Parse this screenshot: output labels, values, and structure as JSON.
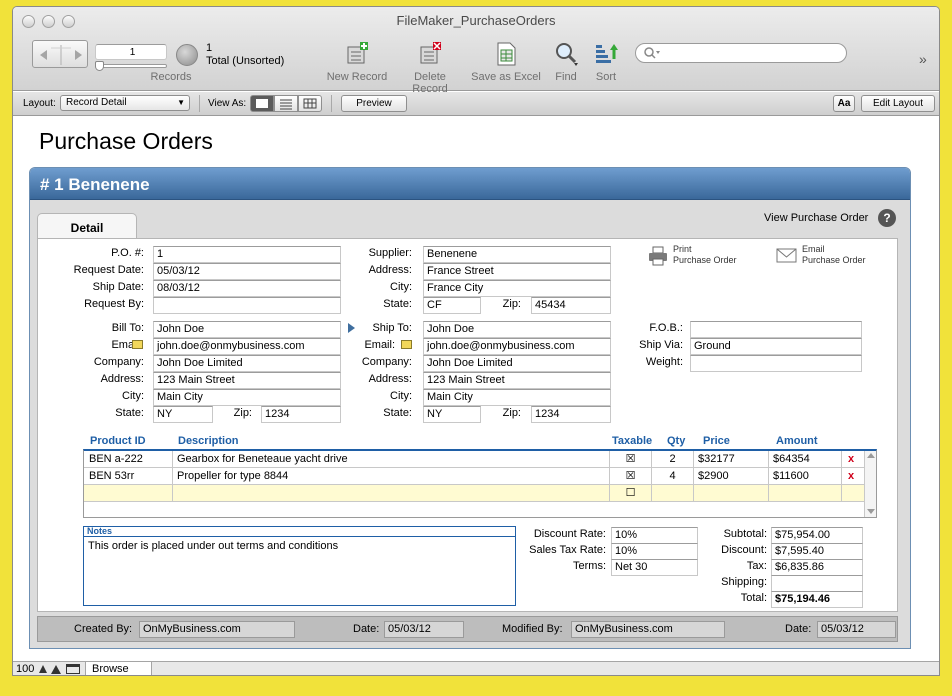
{
  "window": {
    "title": "FileMaker_PurchaseOrders"
  },
  "toolbar": {
    "record_number": "1",
    "record_count": "1",
    "record_status": "Total (Unsorted)",
    "records_label": "Records",
    "buttons": [
      {
        "label": "New Record",
        "icon": "new-record-icon"
      },
      {
        "label": "Delete Record",
        "icon": "delete-record-icon"
      },
      {
        "label": "Save as Excel",
        "icon": "save-excel-icon"
      },
      {
        "label": "Find",
        "icon": "find-icon"
      },
      {
        "label": "Sort",
        "icon": "sort-icon"
      }
    ],
    "search_placeholder": ""
  },
  "layoutbar": {
    "layout_label": "Layout:",
    "layout_value": "Record Detail",
    "view_as_label": "View As:",
    "preview_label": "Preview",
    "aa_label": "Aa",
    "edit_layout_label": "Edit Layout"
  },
  "page": {
    "title": "Purchase Orders",
    "record_header": "# 1 Benenene",
    "tab_detail": "Detail",
    "view_po": "View Purchase Order",
    "help": "?",
    "print_line1": "Print",
    "print_line2": "Purchase Order",
    "email_line1": "Email",
    "email_line2": "Purchase Order"
  },
  "po": {
    "labels": {
      "po": "P.O. #:",
      "request_date": "Request Date:",
      "ship_date": "Ship Date:",
      "request_by": "Request By:"
    },
    "po": "1",
    "request_date": "05/03/12",
    "ship_date": "08/03/12",
    "request_by": ""
  },
  "supplier": {
    "labels": {
      "supplier": "Supplier:",
      "address": "Address:",
      "city": "City:",
      "state": "State:",
      "zip": "Zip:"
    },
    "supplier": "Benenene",
    "address": "France Street",
    "city": "France City",
    "state": "CF",
    "zip": "45434"
  },
  "bill_to": {
    "labels": {
      "bill_to": "Bill To:",
      "email": "Email:",
      "company": "Company:",
      "address": "Address:",
      "city": "City:",
      "state": "State:",
      "zip": "Zip:"
    },
    "name": "John Doe",
    "email": "john.doe@onmybusiness.com",
    "company": "John Doe Limited",
    "address": "123 Main Street",
    "city": "Main City",
    "state": "NY",
    "zip": "1234"
  },
  "ship_to": {
    "labels": {
      "ship_to": "Ship To:",
      "email": "Email:",
      "company": "Company:",
      "address": "Address:",
      "city": "City:",
      "state": "State:",
      "zip": "Zip:"
    },
    "name": "John Doe",
    "email": "john.doe@onmybusiness.com",
    "company": "John Doe Limited",
    "address": "123 Main Street",
    "city": "Main City",
    "state": "NY",
    "zip": "1234"
  },
  "shipping": {
    "labels": {
      "fob": "F.O.B.:",
      "ship_via": "Ship Via:",
      "weight": "Weight:"
    },
    "fob": "",
    "ship_via": "Ground",
    "weight": ""
  },
  "items": {
    "headers": {
      "product_id": "Product ID",
      "description": "Description",
      "taxable": "Taxable",
      "qty": "Qty",
      "price": "Price",
      "amount": "Amount"
    },
    "rows": [
      {
        "product_id": "BEN a-222",
        "description": "Gearbox for Beneteaue yacht drive",
        "taxable": "☒",
        "qty": "2",
        "price": "$32177",
        "amount": "$64354",
        "delete": "x"
      },
      {
        "product_id": "BEN 53rr",
        "description": "Propeller for type 8844",
        "taxable": "☒",
        "qty": "4",
        "price": "$2900",
        "amount": "$11600",
        "delete": "x"
      }
    ],
    "new_row_taxable": "☐"
  },
  "notes": {
    "label": "Notes",
    "text": "This order is placed under out terms and conditions"
  },
  "rates": {
    "labels": {
      "discount_rate": "Discount Rate:",
      "sales_tax_rate": "Sales Tax Rate:",
      "terms": "Terms:"
    },
    "discount_rate": "10%",
    "sales_tax_rate": "10%",
    "terms": "Net 30"
  },
  "totals": {
    "labels": {
      "subtotal": "Subtotal:",
      "discount": "Discount:",
      "tax": "Tax:",
      "shipping": "Shipping:",
      "total": "Total:"
    },
    "subtotal": "$75,954.00",
    "discount": "$7,595.40",
    "tax": "$6,835.86",
    "shipping": "",
    "total": "$75,194.46"
  },
  "footer": {
    "labels": {
      "created_by": "Created By:",
      "date1": "Date:",
      "modified_by": "Modified By:",
      "date2": "Date:"
    },
    "created_by": "OnMyBusiness.com",
    "created_date": "05/03/12",
    "modified_by": "OnMyBusiness.com",
    "modified_date": "05/03/12"
  },
  "statusbar": {
    "zoom": "100",
    "mode": "Browse"
  },
  "colors": {
    "header_blue": "#3f6e9e",
    "column_blue": "#1f5fa6",
    "new_row": "#fffbd2",
    "delete_red": "#d0001a"
  }
}
